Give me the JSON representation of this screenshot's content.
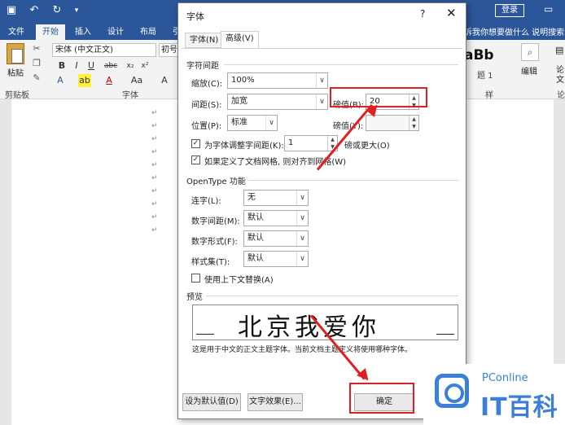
{
  "titlebar": {
    "icons": [
      "save-icon",
      "undo-icon",
      "redo-icon",
      "customize-icon"
    ],
    "login": "登录"
  },
  "ribbon_tabs": [
    "文件",
    "开始",
    "插入",
    "设计",
    "布局",
    "引"
  ],
  "active_tab": "开始",
  "tellme_text": "诉我你想要做什么 说明搜索",
  "ribbon": {
    "paste": "粘贴",
    "font_name": "宋体 (中文正文)",
    "font_size": "初号",
    "group_clipboard": "剪贴板",
    "group_font": "字体",
    "group_styles_fragment": "样",
    "group_right_fragment": "论",
    "styles_sample": "aBb",
    "styles_num": "题 1",
    "edit": "编辑",
    "right_label": "论文"
  },
  "paragraph_mark": "↵",
  "dialog": {
    "title": "字体",
    "help": "?",
    "close": "✕",
    "tabs": [
      "字体(N)",
      "高级(V)"
    ],
    "active_tab": "高级(V)",
    "char_spacing_title": "字符间距",
    "scale_label": "缩放(C):",
    "scale_value": "100%",
    "spacing_label": "间距(S):",
    "spacing_value": "加宽",
    "spacing_by_label": "磅值(B):",
    "spacing_by_value": "20",
    "position_label": "位置(P):",
    "position_value": "标准",
    "position_by_label": "磅值(Y):",
    "position_by_value": "",
    "kerning_check_label": "为字体调整字间距(K):",
    "kerning_value": "1",
    "kerning_suffix": "磅或更大(O)",
    "grid_check_label": "如果定义了文档网格, 则对齐到网格(W)",
    "opentype_title": "OpenType 功能",
    "ligatures_label": "连字(L):",
    "ligatures_value": "无",
    "num_spacing_label": "数字间距(M):",
    "num_spacing_value": "默认",
    "num_forms_label": "数字形式(F):",
    "num_forms_value": "默认",
    "stylistic_label": "样式集(T):",
    "stylistic_value": "默认",
    "contextual_label": "使用上下文替换(A)",
    "preview_title": "预览",
    "preview_text": "北京我爱你",
    "preview_note": "这是用于中文的正文主题字体。当前文档主题定义将使用哪种字体。",
    "default_button": "设为默认值(D)",
    "effects_button": "文字效果(E)...",
    "ok_button": "确定"
  },
  "watermark": {
    "small": "PConline",
    "big": "IT百科"
  },
  "colors": {
    "accent": "#2b579a",
    "highlight": "#e02020"
  }
}
